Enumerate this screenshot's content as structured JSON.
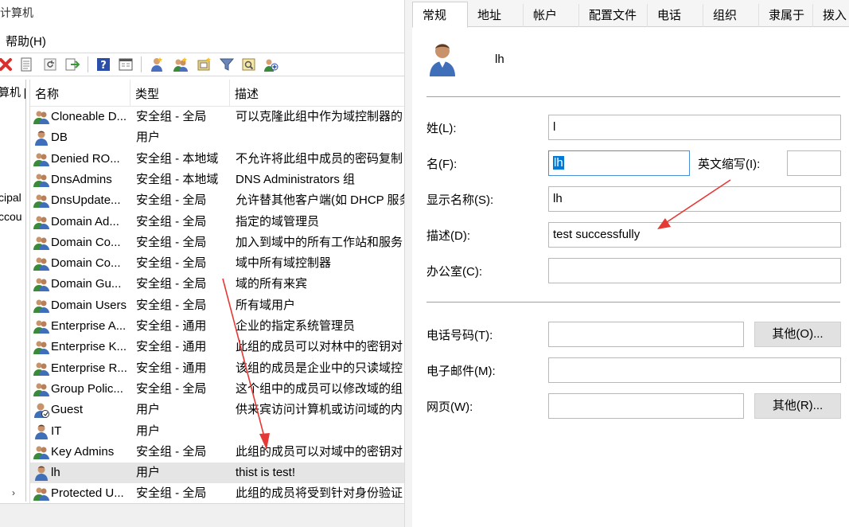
{
  "window": {
    "title_fragment": "计算机",
    "menu_help": "帮助(H)"
  },
  "tree": {
    "items": [
      "算机 [",
      "cipal",
      "ccou"
    ],
    "scroll_glyph": "›"
  },
  "list": {
    "columns": [
      "名称",
      "类型",
      "描述"
    ],
    "rows": [
      {
        "name": "Cloneable D...",
        "type": "安全组 - 全局",
        "desc": "可以克隆此组中作为域控制器的",
        "icon": "group-icon"
      },
      {
        "name": "DB",
        "type": "用户",
        "desc": "",
        "icon": "user-icon"
      },
      {
        "name": "Denied RO...",
        "type": "安全组 - 本地域",
        "desc": "不允许将此组中成员的密码复制",
        "icon": "group-icon"
      },
      {
        "name": "DnsAdmins",
        "type": "安全组 - 本地域",
        "desc": "DNS Administrators 组",
        "icon": "group-icon"
      },
      {
        "name": "DnsUpdate...",
        "type": "安全组 - 全局",
        "desc": "允许替其他客户端(如 DHCP 服务",
        "icon": "group-icon"
      },
      {
        "name": "Domain Ad...",
        "type": "安全组 - 全局",
        "desc": "指定的域管理员",
        "icon": "group-icon"
      },
      {
        "name": "Domain Co...",
        "type": "安全组 - 全局",
        "desc": "加入到域中的所有工作站和服务",
        "icon": "group-icon"
      },
      {
        "name": "Domain Co...",
        "type": "安全组 - 全局",
        "desc": "域中所有域控制器",
        "icon": "group-icon"
      },
      {
        "name": "Domain Gu...",
        "type": "安全组 - 全局",
        "desc": "域的所有来宾",
        "icon": "group-icon"
      },
      {
        "name": "Domain Users",
        "type": "安全组 - 全局",
        "desc": "所有域用户",
        "icon": "group-icon"
      },
      {
        "name": "Enterprise A...",
        "type": "安全组 - 通用",
        "desc": "企业的指定系统管理员",
        "icon": "group-icon"
      },
      {
        "name": "Enterprise K...",
        "type": "安全组 - 通用",
        "desc": "此组的成员可以对林中的密钥对",
        "icon": "group-icon"
      },
      {
        "name": "Enterprise R...",
        "type": "安全组 - 通用",
        "desc": "该组的成员是企业中的只读域控",
        "icon": "group-icon"
      },
      {
        "name": "Group Polic...",
        "type": "安全组 - 全局",
        "desc": "这个组中的成员可以修改域的组",
        "icon": "group-icon"
      },
      {
        "name": "Guest",
        "type": "用户",
        "desc": "供来宾访问计算机或访问域的内",
        "icon": "user-disabled-icon"
      },
      {
        "name": "IT",
        "type": "用户",
        "desc": "",
        "icon": "user-icon"
      },
      {
        "name": "Key Admins",
        "type": "安全组 - 全局",
        "desc": "此组的成员可以对域中的密钥对",
        "icon": "group-icon"
      },
      {
        "name": "lh",
        "type": "用户",
        "desc": "thist is test!",
        "icon": "user-icon",
        "selected": true
      },
      {
        "name": "Protected U...",
        "type": "安全组 - 全局",
        "desc": "此组的成员将受到针对身份验证",
        "icon": "group-icon"
      }
    ]
  },
  "dialog": {
    "tabs": [
      "常规",
      "地址",
      "帐户",
      "配置文件",
      "电话",
      "组织",
      "隶属于",
      "拨入"
    ],
    "active_tab": "常规",
    "user_name": "lh",
    "fields": {
      "last_name": {
        "label": "姓(L):",
        "value": "l"
      },
      "first_name": {
        "label": "名(F):",
        "value": "lh"
      },
      "initials": {
        "label": "英文缩写(I):",
        "value": ""
      },
      "display_name": {
        "label": "显示名称(S):",
        "value": "lh"
      },
      "description": {
        "label": "描述(D):",
        "value": "test successfully"
      },
      "office": {
        "label": "办公室(C):",
        "value": ""
      },
      "phone": {
        "label": "电话号码(T):",
        "value": ""
      },
      "email": {
        "label": "电子邮件(M):",
        "value": ""
      },
      "webpage": {
        "label": "网页(W):",
        "value": ""
      }
    },
    "buttons": {
      "phone_other": "其他(O)...",
      "web_other": "其他(R)..."
    }
  },
  "colors": {
    "selection": "#0078d7",
    "arrow": "#e53935",
    "selected_row": "#e5e5e5"
  }
}
